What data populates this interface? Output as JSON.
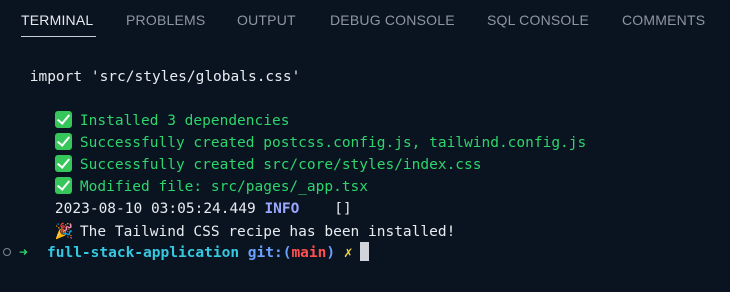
{
  "tabs": [
    {
      "label": "TERMINAL",
      "active": true
    },
    {
      "label": "PROBLEMS",
      "active": false
    },
    {
      "label": "OUTPUT",
      "active": false
    },
    {
      "label": "DEBUG CONSOLE",
      "active": false
    },
    {
      "label": "SQL CONSOLE",
      "active": false
    },
    {
      "label": "COMMENTS",
      "active": false
    }
  ],
  "terminal": {
    "import_line": " import 'src/styles/globals.css'",
    "success_lines": [
      "Installed 3 dependencies",
      "Successfully created postcss.config.js, tailwind.config.js",
      "Successfully created src/core/styles/index.css",
      "Modified file: src/pages/_app.tsx"
    ],
    "log_timestamp": "2023-08-10 03:05:24.449",
    "log_level": "INFO",
    "log_message": "[]",
    "final_message": "The Tailwind CSS recipe has been installed!"
  },
  "prompt": {
    "arrow": "➜",
    "directory": "full-stack-application",
    "git_label": "git:",
    "open_paren": "(",
    "branch": "main",
    "close_paren": ")",
    "dirty_marker": "✗"
  },
  "colors": {
    "background": "#0a1320",
    "success_green": "#2dd56c",
    "info_blue": "#9aa7ff",
    "directory_cyan": "#36c8e0",
    "git_blue": "#6aa0ff",
    "branch_red": "#ff4f4f",
    "dirty_yellow": "#f2d34d"
  },
  "icons": {
    "success": "check-mark-button-icon",
    "celebrate": "party-popper-icon",
    "prompt_status": "circle-icon"
  }
}
